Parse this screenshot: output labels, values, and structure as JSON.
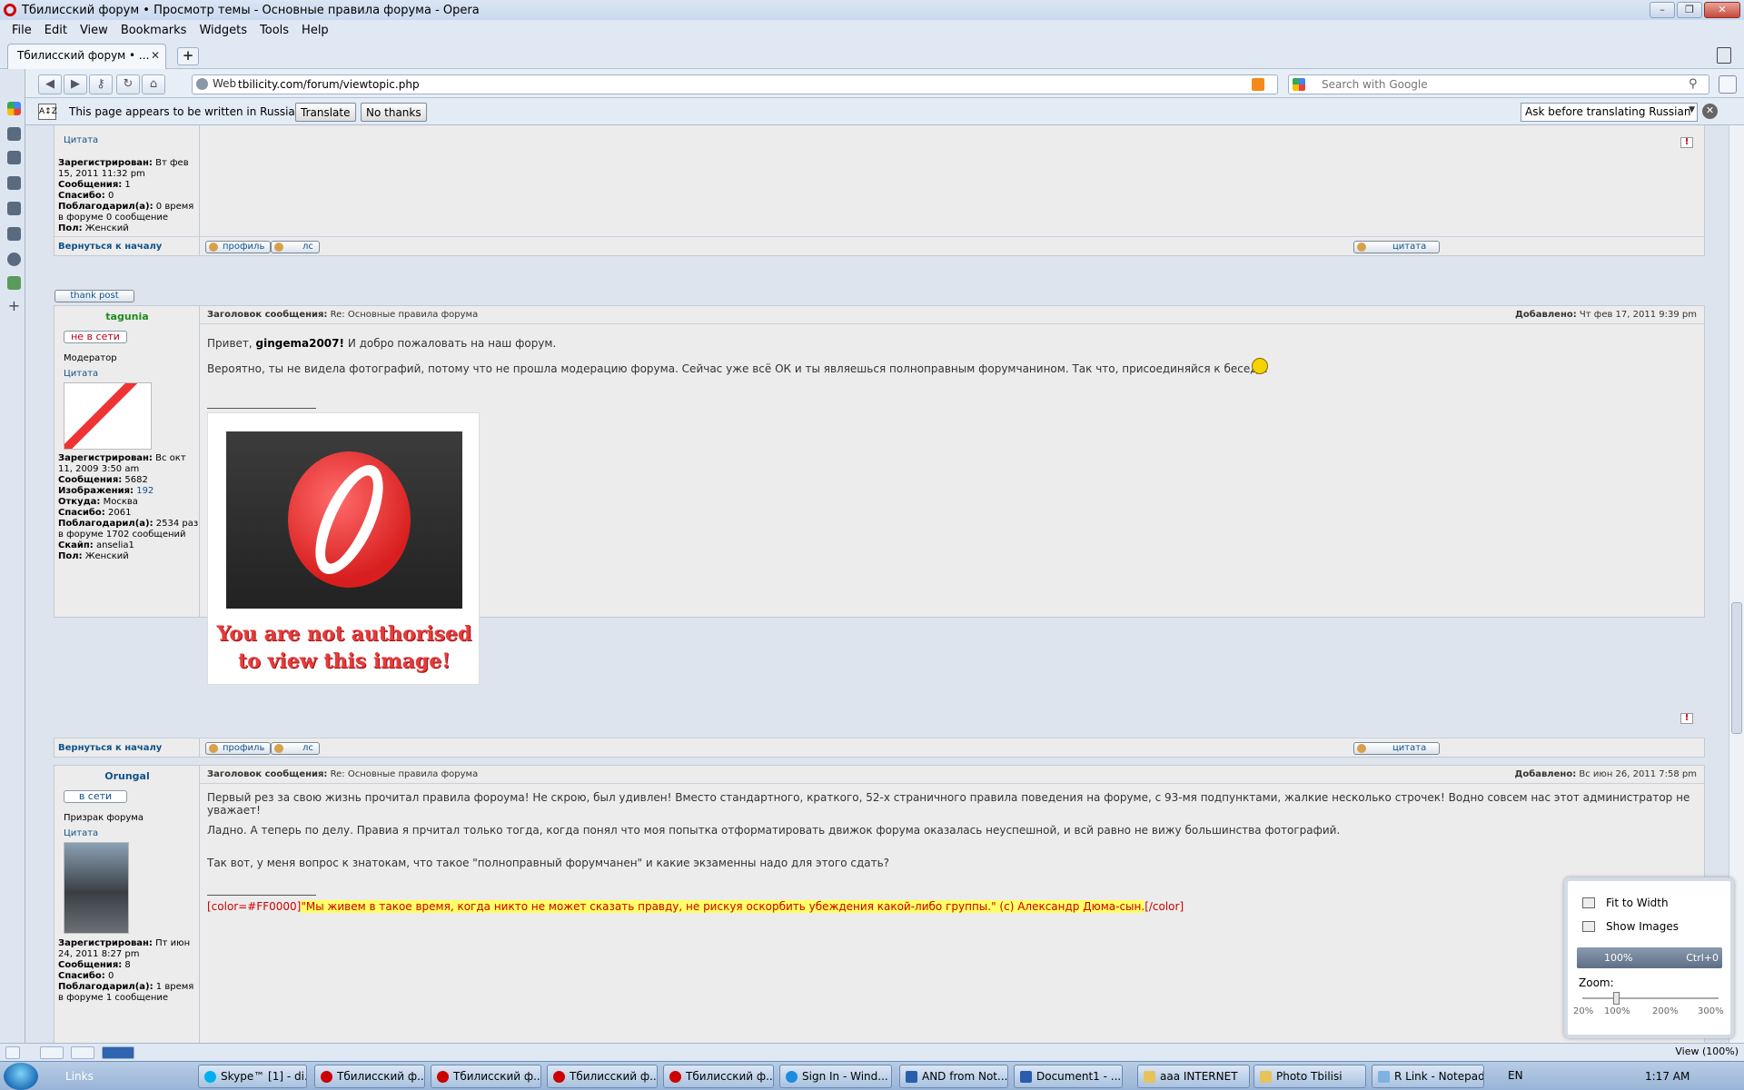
{
  "window": {
    "title": "Тбилисский форум • Просмотр темы - Основные правила форума - Opera"
  },
  "menu": [
    "File",
    "Edit",
    "View",
    "Bookmarks",
    "Widgets",
    "Tools",
    "Help"
  ],
  "tab": {
    "label": "Тбилисский форум • ..."
  },
  "address": {
    "badge": "Web",
    "url": "tbilicity.com/forum/viewtopic.php",
    "search_placeholder": "Search with Google"
  },
  "translate": {
    "message": "This page appears to be written in Russian.",
    "translate_label": "Translate",
    "nothanks_label": "No thanks",
    "option": "Ask before translating Russian"
  },
  "posts": {
    "top": {
      "citata": "Цитата",
      "info": [
        {
          "k": "Зарегистрирован:",
          "v": "Вт фев 15, 2011 11:32 pm"
        },
        {
          "k": "Сообщения:",
          "v": "1"
        },
        {
          "k": "Спасибо:",
          "v": "0"
        },
        {
          "k": "Поблагодарил(а):",
          "v": "0 время в форуме 0 сообщение"
        },
        {
          "k": "Пол:",
          "v": "Женский"
        }
      ]
    },
    "p1": {
      "username": "tagunia",
      "status": "не в сети",
      "rank": "Модератор",
      "citata": "Цитата",
      "title_label": "Заголовок сообщения:",
      "title": "Re: Основные правила форума",
      "date_label": "Добавлено:",
      "date": "Чт фев 17, 2011 9:39 pm",
      "greeting_pre": "Привет,",
      "greeting_name": "gingema2007!",
      "greeting_post": "И добро пожаловать на наш форум.",
      "body": "Вероятно, ты не видела фотографий, потому что не прошла модерацию форума. Сейчас уже всё ОК и ты являешься полноправным форумчанином. Так что, присоединяйся к беседе.",
      "blocked_text": "You are not authorised to view this image!",
      "info": [
        {
          "k": "Зарегистрирован:",
          "v": "Вс окт 11, 2009 3:50 am"
        },
        {
          "k": "Сообщения:",
          "v": "5682"
        },
        {
          "k": "Изображения:",
          "v": "192"
        },
        {
          "k": "Откуда:",
          "v": "Москва"
        },
        {
          "k": "Спасибо:",
          "v": "2061"
        },
        {
          "k": "Поблагодарил(а):",
          "v": "2534 раз в форуме 1702 сообщений"
        },
        {
          "k": "Скайп:",
          "v": "anselia1"
        },
        {
          "k": "Пол:",
          "v": "Женский"
        }
      ]
    },
    "p2": {
      "username": "Orungal",
      "status": "в сети",
      "rank": "Призрак форума",
      "citata": "Цитата",
      "title_label": "Заголовок сообщения:",
      "title": "Re: Основные правила форума",
      "date_label": "Добавлено:",
      "date": "Вс июн 26, 2011 7:58 pm",
      "para1": "Первый рез за свою жизнь прочитал правила фороума! Не скрою, был удивлен! Вместо стандартного, краткого, 52-х страничного правила поведения на форуме, с 93-мя подпунктами, жалкие несколько строчек! Водно совсем нас этот администратор не уважает!",
      "para2": "Ладно. А теперь по делу. Правиа я прчитал только тогда, когда понял что моя попытка отформатировать движок форума оказалась неуспешной, и всй равно не вижу большинства фотографий.",
      "para3": "Так вот, у меня вопрос к знатокам, что такое \"полноправный форумчанен\" и какие экзаменны надо для этого сдать?",
      "sig_open": "[color=#FF0000]",
      "sig_text": "\"Мы живем в такое время, когда никто не может сказать правду, не рискуя оскорбить убеждения какой-либо группы.\" (с) Александр Дюма-сын.",
      "sig_close": "[/color]",
      "info": [
        {
          "k": "Зарегистрирован:",
          "v": "Пт июн 24, 2011 8:27 pm"
        },
        {
          "k": "Сообщения:",
          "v": "8"
        },
        {
          "k": "Спасибо:",
          "v": "0"
        },
        {
          "k": "Поблагодарил(а):",
          "v": "1 время в форуме 1 сообщение"
        }
      ]
    }
  },
  "post_actions": {
    "back_to_top": "Вернуться к началу",
    "profile": "профиль",
    "pm": "лс",
    "quote": "цитата",
    "thank": "thank post"
  },
  "zoom": {
    "fit_width": "Fit to Width",
    "show_images": "Show Images",
    "current": "100%",
    "shortcut": "Ctrl+0",
    "zoom_label": "Zoom:",
    "ticks": [
      "20%",
      "100%",
      "200%",
      "300%"
    ],
    "status_label": "View (100%)"
  },
  "taskbar": {
    "links": "Links",
    "items": [
      {
        "label": "Skype™ [1] - di...",
        "kind": "sky"
      },
      {
        "label": "Тбилисский ф...",
        "kind": "op"
      },
      {
        "label": "Тбилисский ф...",
        "kind": "op"
      },
      {
        "label": "Тбилисский ф...",
        "kind": "op"
      },
      {
        "label": "Тбилисский ф...",
        "kind": "op"
      },
      {
        "label": "Sign In - Wind...",
        "kind": "ie"
      },
      {
        "label": "AND from Not...",
        "kind": "word"
      },
      {
        "label": "Document1 - ...",
        "kind": "word"
      },
      {
        "label": "aaa INTERNET",
        "kind": "fold"
      },
      {
        "label": "Photo Tbilisi",
        "kind": "fold"
      },
      {
        "label": "R Link - Notepad",
        "kind": "note"
      }
    ],
    "lang": "EN",
    "time": "1:17 AM"
  }
}
